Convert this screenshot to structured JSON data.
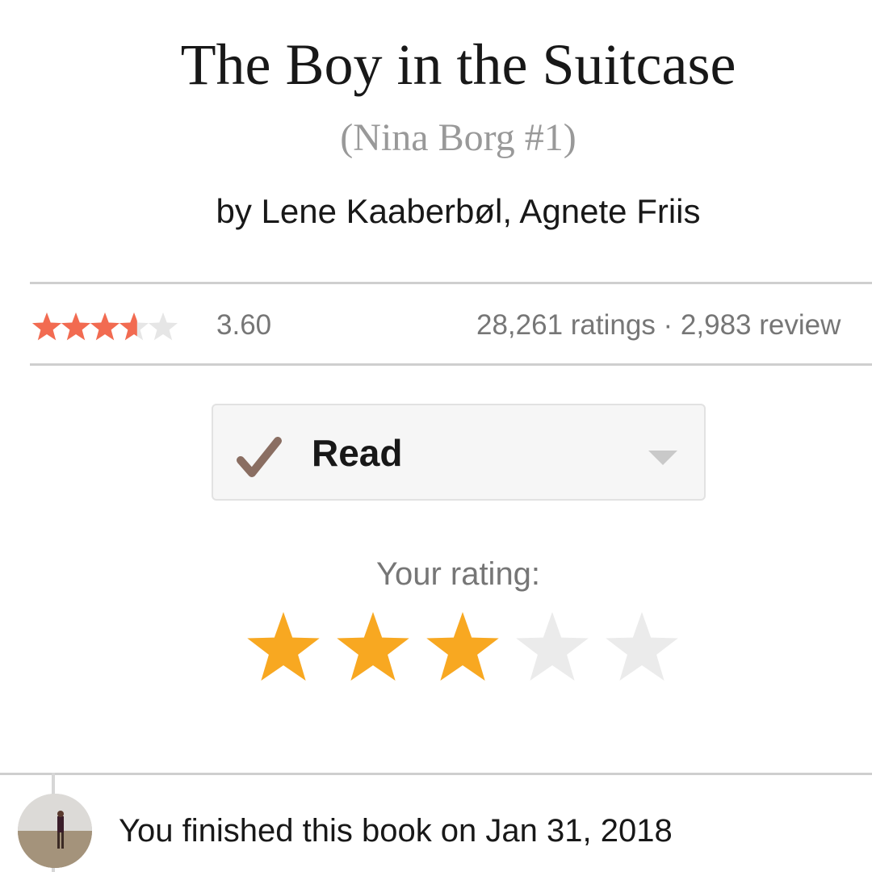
{
  "book": {
    "title": "The Boy in the Suitcase",
    "series": "(Nina Borg #1)",
    "authors": "by Lene Kaaberbøl, Agnete Friis"
  },
  "community_rating": {
    "average": "3.60",
    "average_value": 3.6,
    "max": 5,
    "counts": "28,261 ratings · 2,983 review",
    "star_color": "#f26b51",
    "empty_star_color": "#e6e6e6"
  },
  "shelf_button": {
    "label": "Read",
    "check_icon": "checkmark-icon",
    "check_color": "#8a6e62",
    "dropdown_icon": "caret-down-icon"
  },
  "your_rating": {
    "label": "Your rating:",
    "value": 3,
    "max": 5,
    "filled_color": "#f8a821",
    "empty_color": "#ebebeb"
  },
  "activity": {
    "avatar_icon": "user-avatar",
    "text": "You finished this book on Jan 31, 2018"
  }
}
